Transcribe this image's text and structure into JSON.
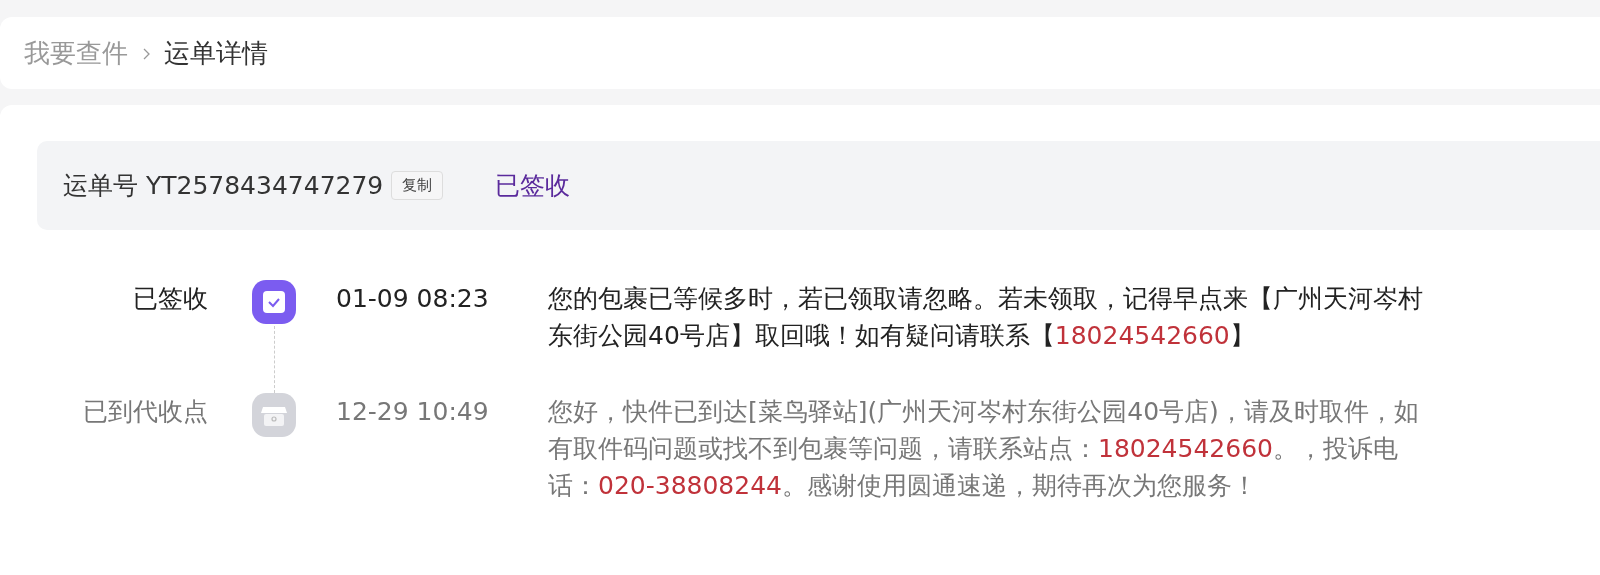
{
  "breadcrumb": [
    {
      "label": "我要查件",
      "current": false
    },
    {
      "label": "运单详情",
      "current": true
    }
  ],
  "waybill": {
    "label": "运单号",
    "number": "YT2578434747279",
    "copy_button": "复制",
    "status": "已签收"
  },
  "timeline": [
    {
      "status": "已签收",
      "time": "01-09 08:23",
      "current": true,
      "kind": "signed",
      "segments": [
        {
          "kind": "text",
          "text": "您的包裹已等候多时，若已领取请忽略。若未领取，记得早点来【广州天河岑村东街公园40号店】取回哦！如有疑问请联系【"
        },
        {
          "kind": "phone",
          "text": "18024542660"
        },
        {
          "kind": "text",
          "text": "】"
        }
      ]
    },
    {
      "status": "已到代收点",
      "time": "12-29 10:49",
      "current": false,
      "kind": "station",
      "segments": [
        {
          "kind": "text",
          "text": "您好，快件已到达[菜鸟驿站](广州天河岑村东街公园40号店)，请及时取件，如有取件码问题或找不到包裹等问题，请联系站点："
        },
        {
          "kind": "phone",
          "text": "18024542660"
        },
        {
          "kind": "text",
          "text": "。，投诉电话："
        },
        {
          "kind": "phone",
          "text": "020-38808244"
        },
        {
          "kind": "text",
          "text": "。感谢使用圆通速递，期待再次为您服务！"
        }
      ]
    }
  ]
}
